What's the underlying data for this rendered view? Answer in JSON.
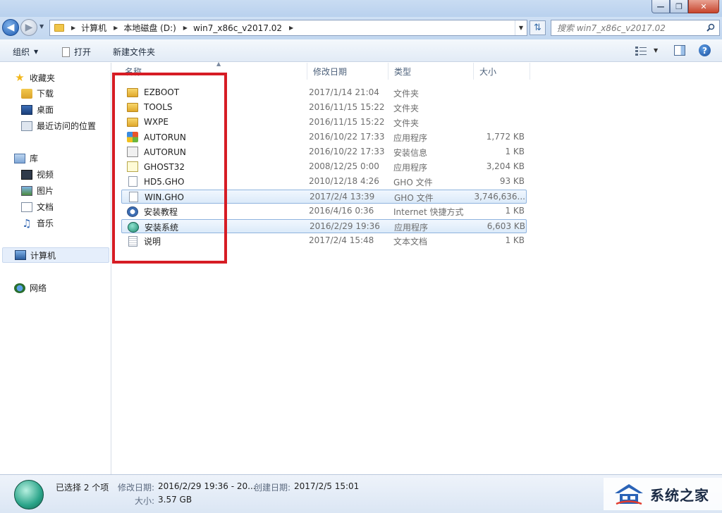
{
  "window": {
    "min_label": "—",
    "max_label": "❐",
    "close_label": "✕"
  },
  "address": {
    "crumbs": [
      "计算机",
      "本地磁盘 (D:)",
      "win7_x86c_v2017.02"
    ],
    "search_placeholder": "搜索 win7_x86c_v2017.02"
  },
  "toolbar": {
    "organize": "组织",
    "open": "打开",
    "new_folder": "新建文件夹"
  },
  "nav": {
    "favorites": "收藏夹",
    "favorites_items": [
      "下载",
      "桌面",
      "最近访问的位置"
    ],
    "library": "库",
    "library_items": [
      "视频",
      "图片",
      "文档",
      "音乐"
    ],
    "computer": "计算机",
    "network": "网络"
  },
  "columns": {
    "name": "名称",
    "date": "修改日期",
    "type": "类型",
    "size": "大小"
  },
  "files": [
    {
      "name": "EZBOOT",
      "date": "2017/1/14 21:04",
      "type": "文件夹",
      "size": "",
      "icon": "folder-icon",
      "selected": false
    },
    {
      "name": "TOOLS",
      "date": "2016/11/15 15:22",
      "type": "文件夹",
      "size": "",
      "icon": "folder-icon",
      "selected": false
    },
    {
      "name": "WXPE",
      "date": "2016/11/15 15:22",
      "type": "文件夹",
      "size": "",
      "icon": "folder-icon",
      "selected": false
    },
    {
      "name": "AUTORUN",
      "date": "2016/10/22 17:33",
      "type": "应用程序",
      "size": "1,772 KB",
      "icon": "application-icon",
      "selected": false
    },
    {
      "name": "AUTORUN",
      "date": "2016/10/22 17:33",
      "type": "安装信息",
      "size": "1 KB",
      "icon": "setup-info-icon",
      "selected": false
    },
    {
      "name": "GHOST32",
      "date": "2008/12/25 0:00",
      "type": "应用程序",
      "size": "3,204 KB",
      "icon": "ghost-icon",
      "selected": false
    },
    {
      "name": "HD5.GHO",
      "date": "2010/12/18 4:26",
      "type": "GHO 文件",
      "size": "93 KB",
      "icon": "file-icon",
      "selected": false
    },
    {
      "name": "WIN.GHO",
      "date": "2017/2/4 13:39",
      "type": "GHO 文件",
      "size": "3,746,636...",
      "icon": "file-icon",
      "selected": true
    },
    {
      "name": "安装教程",
      "date": "2016/4/16 0:36",
      "type": "Internet 快捷方式",
      "size": "1 KB",
      "icon": "internet-shortcut-icon",
      "selected": false
    },
    {
      "name": "安装系统",
      "date": "2016/2/29 19:36",
      "type": "应用程序",
      "size": "6,603 KB",
      "icon": "installer-icon",
      "selected": true
    },
    {
      "name": "说明",
      "date": "2017/2/4 15:48",
      "type": "文本文档",
      "size": "1 KB",
      "icon": "text-document-icon",
      "selected": false
    }
  ],
  "details": {
    "selected_count": "已选择 2 个项",
    "modified_label": "修改日期:",
    "modified_value": "2016/2/29 19:36 - 20...",
    "created_label": "创建日期:",
    "created_value": "2017/2/5 15:01",
    "size_label": "大小:",
    "size_value": "3.57 GB"
  },
  "watermark": {
    "text": "系统之家"
  },
  "colors": {
    "highlight_box": "#d61c24",
    "selection": "#dbeaf9"
  }
}
